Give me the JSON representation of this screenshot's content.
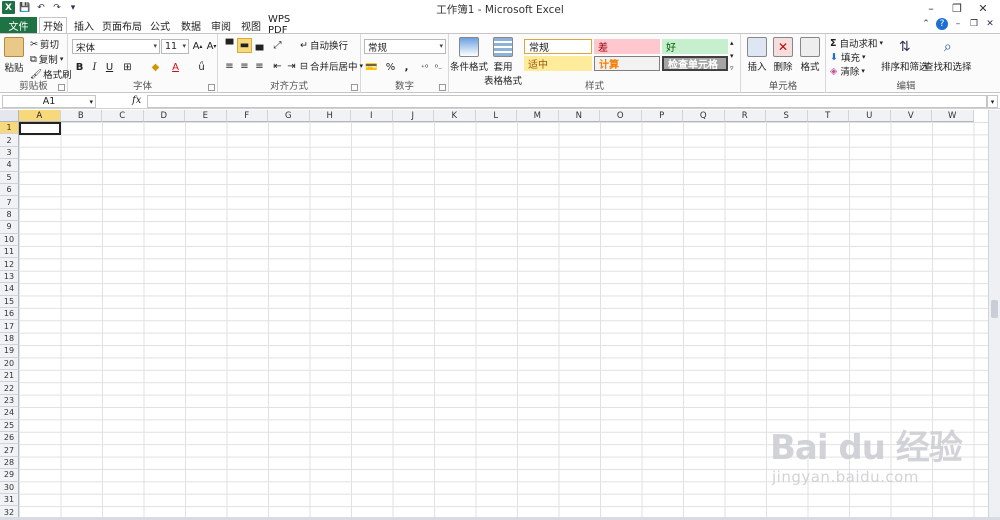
{
  "window": {
    "title": "工作簿1 - Microsoft Excel"
  },
  "qat": {
    "logo": "X"
  },
  "tabs": [
    {
      "label": "文件"
    },
    {
      "label": "开始"
    },
    {
      "label": "插入"
    },
    {
      "label": "页面布局"
    },
    {
      "label": "公式"
    },
    {
      "label": "数据"
    },
    {
      "label": "审阅"
    },
    {
      "label": "视图"
    },
    {
      "label": "WPS PDF"
    }
  ],
  "ribbon": {
    "clipboard": {
      "paste": "粘贴",
      "cut": "剪切",
      "copy": "复制",
      "format_painter": "格式刷",
      "label": "剪贴板"
    },
    "font": {
      "name": "宋体",
      "size": "11",
      "bold": "B",
      "italic": "I",
      "underline": "U",
      "label": "字体",
      "font_color": "A"
    },
    "alignment": {
      "wrap": "自动换行",
      "merge": "合并后居中",
      "label": "对齐方式"
    },
    "number": {
      "format": "常规",
      "percent": "%",
      "comma": ",",
      "label": "数字"
    },
    "styles": {
      "cond_format": "条件格式",
      "table_format_1": "套用",
      "table_format_2": "表格格式",
      "normal": "常规",
      "bad": "差",
      "good": "好",
      "neutral": "适中",
      "calculation": "计算",
      "check_cell": "检查单元格",
      "label": "样式"
    },
    "cells": {
      "insert": "插入",
      "delete": "删除",
      "format": "格式",
      "label": "单元格"
    },
    "editing": {
      "autosum": "自动求和",
      "fill": "填充",
      "clear": "清除",
      "sort_filter": "排序和筛选",
      "find_select": "查找和选择",
      "label": "编辑"
    }
  },
  "formula_bar": {
    "name_box": "A1",
    "fx": "fx",
    "value": ""
  },
  "grid": {
    "columns": [
      "A",
      "B",
      "C",
      "D",
      "E",
      "F",
      "G",
      "H",
      "I",
      "J",
      "K",
      "L",
      "M",
      "N",
      "O",
      "P",
      "Q",
      "R",
      "S",
      "T",
      "U",
      "V",
      "W"
    ],
    "rows": [
      "1",
      "2",
      "3",
      "4",
      "5",
      "6",
      "7",
      "8",
      "9",
      "10",
      "11",
      "12",
      "13",
      "14",
      "15",
      "16",
      "17",
      "18",
      "19",
      "20",
      "21",
      "22",
      "23",
      "24",
      "25",
      "26",
      "27",
      "28",
      "29",
      "30",
      "31",
      "32"
    ],
    "selected_column": "A",
    "selected_row": "1"
  },
  "watermark": {
    "main": "Bai du 经验",
    "sub": "jingyan.baidu.com"
  },
  "colors": {
    "file_tab": "#1f7244",
    "select_yellow": "#f7d87a"
  }
}
